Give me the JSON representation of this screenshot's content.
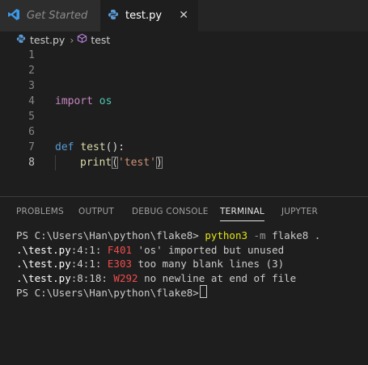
{
  "tabs": [
    {
      "label": "Get Started",
      "icon": "vscode-logo-icon"
    },
    {
      "label": "test.py",
      "icon": "python-icon",
      "close": "✕"
    }
  ],
  "breadcrumb": {
    "file": "test.py",
    "separator": "›",
    "symbol": "test"
  },
  "editor": {
    "line_numbers": [
      "1",
      "2",
      "3",
      "4",
      "5",
      "6",
      "7",
      "8"
    ],
    "lines": {
      "l4_kw": "import",
      "l4_mod": "os",
      "l7_kw": "def",
      "l7_fn": "test",
      "l7_rest": "():",
      "l8_fn": "print",
      "l8_open": "(",
      "l8_str": "'test'",
      "l8_close": ")"
    }
  },
  "panel": {
    "tabs": [
      "PROBLEMS",
      "OUTPUT",
      "DEBUG CONSOLE",
      "TERMINAL",
      "JUPYTER"
    ],
    "active_tab": "TERMINAL",
    "terminal": {
      "prompt": "PS C:\\Users\\Han\\python\\flake8>",
      "cmd_exe": "python3",
      "cmd_flag": "-m",
      "cmd_args": "flake8 .",
      "rows": [
        {
          "file": ".\\test.py",
          "pos": ":4:1:",
          "code": "F401",
          "msg": "'os' imported but unused"
        },
        {
          "file": ".\\test.py",
          "pos": ":4:1:",
          "code": "E303",
          "msg": "too many blank lines (3)"
        },
        {
          "file": ".\\test.py",
          "pos": ":8:18:",
          "code": "W292",
          "msg": "no newline at end of file"
        }
      ],
      "prompt2": "PS C:\\Users\\Han\\python\\flake8>"
    }
  }
}
